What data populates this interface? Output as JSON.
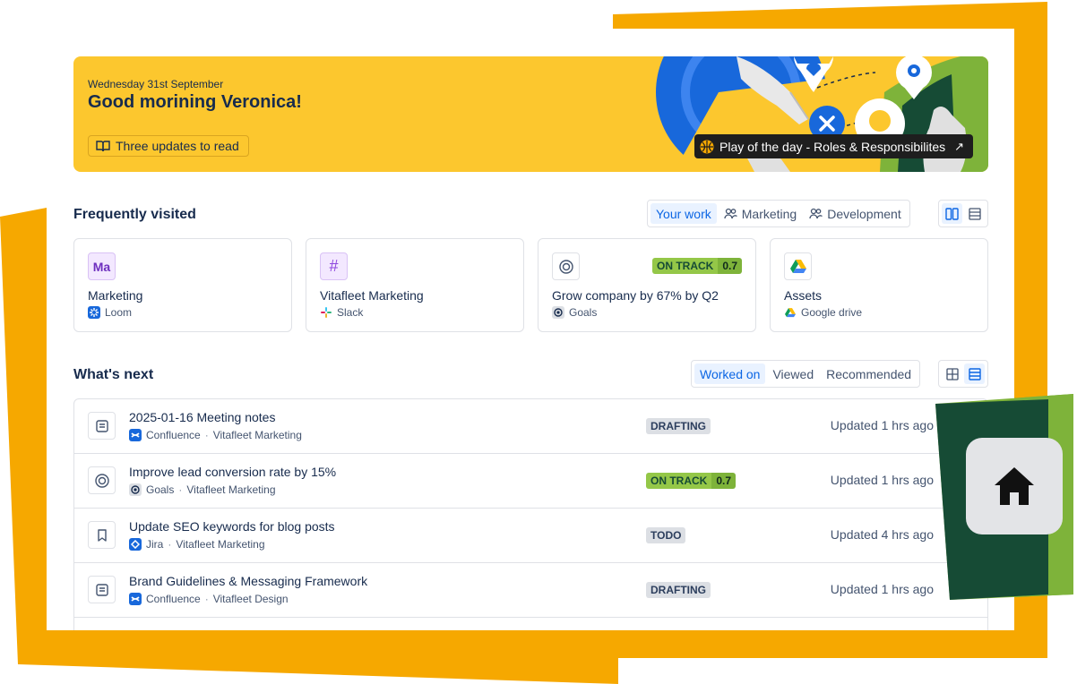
{
  "colors": {
    "orange": "#f6a800",
    "banner_yellow": "#fcc72e",
    "dark_green": "#164b35",
    "light_green": "#7eb33a",
    "accent_blue": "#0c66e4",
    "text": "#172b4d"
  },
  "banner": {
    "date": "Wednesday 31st September",
    "greeting": "Good morining Veronica!",
    "updates_label": "Three updates to read",
    "updates_icon": "book-open-icon",
    "play_label": "Play of the day - Roles & Responsibilites",
    "play_icon": "basketball-icon",
    "play_arrow": "↗"
  },
  "frequently_visited": {
    "title": "Frequently visited",
    "filters": [
      {
        "label": "Your work",
        "active": true
      },
      {
        "label": "Marketing",
        "icon": "people-icon"
      },
      {
        "label": "Development",
        "icon": "people-icon"
      }
    ],
    "cards": [
      {
        "icon_text": "Ma",
        "title": "Marketing",
        "source": "Loom"
      },
      {
        "icon_text": "#",
        "title": "Vitafleet Marketing",
        "source": "Slack"
      },
      {
        "title": "Grow company by 67% by Q2",
        "source": "Goals",
        "status": "ON TRACK",
        "score": "0.7"
      },
      {
        "title": "Assets",
        "source": "Google drive"
      }
    ]
  },
  "whats_next": {
    "title": "What's next",
    "filters": [
      {
        "label": "Worked on",
        "active": true
      },
      {
        "label": "Viewed"
      },
      {
        "label": "Recommended"
      }
    ],
    "rows": [
      {
        "title": "2025-01-16 Meeting notes",
        "app": "Confluence",
        "space": "Vitafleet Marketing",
        "status": "DRAFTING",
        "updated": "Updated 1 hrs ago",
        "icon": "page-icon"
      },
      {
        "title": "Improve lead conversion rate by 15%",
        "app": "Goals",
        "space": "Vitafleet Marketing",
        "status": "ON TRACK",
        "score": "0.7",
        "updated": "Updated 1 hrs ago",
        "icon": "target-icon"
      },
      {
        "title": "Update SEO keywords for blog posts",
        "app": "Jira",
        "space": "Vitafleet Marketing",
        "status": "TODO",
        "updated": "Updated 4 hrs ago",
        "icon": "bookmark-icon"
      },
      {
        "title": "Brand Guidelines & Messaging Framework",
        "app": "Confluence",
        "space": "Vitafleet Design",
        "status": "DRAFTING",
        "updated": "Updated 1 hrs ago",
        "icon": "page-icon"
      }
    ]
  },
  "separator": "·",
  "home_icon": "home-icon"
}
